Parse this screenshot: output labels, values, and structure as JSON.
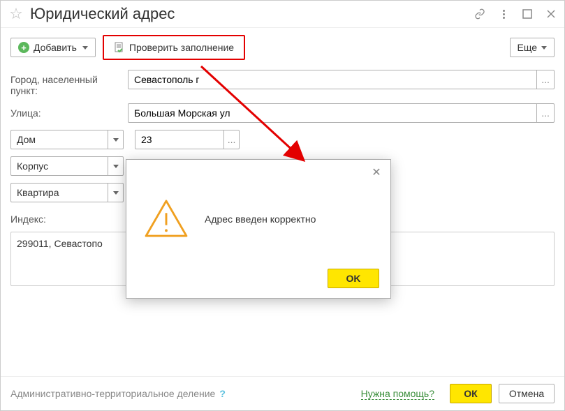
{
  "header": {
    "title": "Юридический адрес"
  },
  "toolbar": {
    "add_label": "Добавить",
    "verify_label": "Проверить заполнение",
    "more_label": "Еще"
  },
  "form": {
    "city_label": "Город, населенный пункт:",
    "city_value": "Севастополь г",
    "street_label": "Улица:",
    "street_value": "Большая Морская ул",
    "house_type": "Дом",
    "house_value": "23",
    "block_type": "Корпус",
    "block_value": "",
    "apartment_type": "Квартира",
    "apartment_value": "",
    "index_label": "Индекс:",
    "summary_value": "299011, Севастопо"
  },
  "footer": {
    "admin_division_label": "Административно-территориальное деление",
    "help_link": "Нужна помощь?",
    "ok_label": "ОК",
    "cancel_label": "Отмена"
  },
  "dialog": {
    "message": "Адрес введен корректно",
    "ok_label": "OK"
  }
}
